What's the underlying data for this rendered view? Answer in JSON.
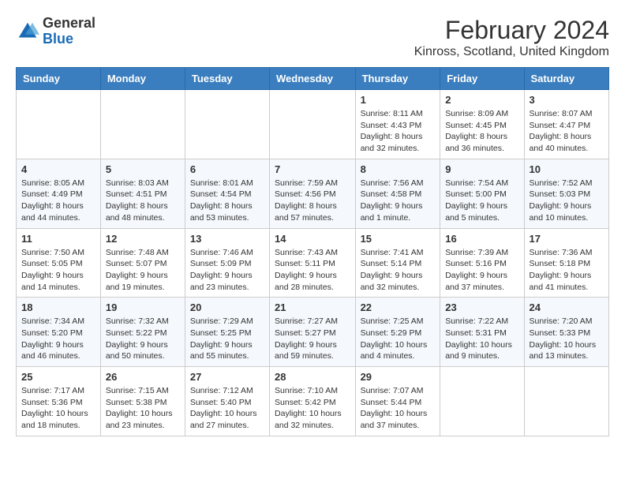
{
  "logo": {
    "general": "General",
    "blue": "Blue"
  },
  "title": "February 2024",
  "subtitle": "Kinross, Scotland, United Kingdom",
  "headers": [
    "Sunday",
    "Monday",
    "Tuesday",
    "Wednesday",
    "Thursday",
    "Friday",
    "Saturday"
  ],
  "weeks": [
    [
      {
        "day": "",
        "info": ""
      },
      {
        "day": "",
        "info": ""
      },
      {
        "day": "",
        "info": ""
      },
      {
        "day": "",
        "info": ""
      },
      {
        "day": "1",
        "info": "Sunrise: 8:11 AM\nSunset: 4:43 PM\nDaylight: 8 hours\nand 32 minutes."
      },
      {
        "day": "2",
        "info": "Sunrise: 8:09 AM\nSunset: 4:45 PM\nDaylight: 8 hours\nand 36 minutes."
      },
      {
        "day": "3",
        "info": "Sunrise: 8:07 AM\nSunset: 4:47 PM\nDaylight: 8 hours\nand 40 minutes."
      }
    ],
    [
      {
        "day": "4",
        "info": "Sunrise: 8:05 AM\nSunset: 4:49 PM\nDaylight: 8 hours\nand 44 minutes."
      },
      {
        "day": "5",
        "info": "Sunrise: 8:03 AM\nSunset: 4:51 PM\nDaylight: 8 hours\nand 48 minutes."
      },
      {
        "day": "6",
        "info": "Sunrise: 8:01 AM\nSunset: 4:54 PM\nDaylight: 8 hours\nand 53 minutes."
      },
      {
        "day": "7",
        "info": "Sunrise: 7:59 AM\nSunset: 4:56 PM\nDaylight: 8 hours\nand 57 minutes."
      },
      {
        "day": "8",
        "info": "Sunrise: 7:56 AM\nSunset: 4:58 PM\nDaylight: 9 hours\nand 1 minute."
      },
      {
        "day": "9",
        "info": "Sunrise: 7:54 AM\nSunset: 5:00 PM\nDaylight: 9 hours\nand 5 minutes."
      },
      {
        "day": "10",
        "info": "Sunrise: 7:52 AM\nSunset: 5:03 PM\nDaylight: 9 hours\nand 10 minutes."
      }
    ],
    [
      {
        "day": "11",
        "info": "Sunrise: 7:50 AM\nSunset: 5:05 PM\nDaylight: 9 hours\nand 14 minutes."
      },
      {
        "day": "12",
        "info": "Sunrise: 7:48 AM\nSunset: 5:07 PM\nDaylight: 9 hours\nand 19 minutes."
      },
      {
        "day": "13",
        "info": "Sunrise: 7:46 AM\nSunset: 5:09 PM\nDaylight: 9 hours\nand 23 minutes."
      },
      {
        "day": "14",
        "info": "Sunrise: 7:43 AM\nSunset: 5:11 PM\nDaylight: 9 hours\nand 28 minutes."
      },
      {
        "day": "15",
        "info": "Sunrise: 7:41 AM\nSunset: 5:14 PM\nDaylight: 9 hours\nand 32 minutes."
      },
      {
        "day": "16",
        "info": "Sunrise: 7:39 AM\nSunset: 5:16 PM\nDaylight: 9 hours\nand 37 minutes."
      },
      {
        "day": "17",
        "info": "Sunrise: 7:36 AM\nSunset: 5:18 PM\nDaylight: 9 hours\nand 41 minutes."
      }
    ],
    [
      {
        "day": "18",
        "info": "Sunrise: 7:34 AM\nSunset: 5:20 PM\nDaylight: 9 hours\nand 46 minutes."
      },
      {
        "day": "19",
        "info": "Sunrise: 7:32 AM\nSunset: 5:22 PM\nDaylight: 9 hours\nand 50 minutes."
      },
      {
        "day": "20",
        "info": "Sunrise: 7:29 AM\nSunset: 5:25 PM\nDaylight: 9 hours\nand 55 minutes."
      },
      {
        "day": "21",
        "info": "Sunrise: 7:27 AM\nSunset: 5:27 PM\nDaylight: 9 hours\nand 59 minutes."
      },
      {
        "day": "22",
        "info": "Sunrise: 7:25 AM\nSunset: 5:29 PM\nDaylight: 10 hours\nand 4 minutes."
      },
      {
        "day": "23",
        "info": "Sunrise: 7:22 AM\nSunset: 5:31 PM\nDaylight: 10 hours\nand 9 minutes."
      },
      {
        "day": "24",
        "info": "Sunrise: 7:20 AM\nSunset: 5:33 PM\nDaylight: 10 hours\nand 13 minutes."
      }
    ],
    [
      {
        "day": "25",
        "info": "Sunrise: 7:17 AM\nSunset: 5:36 PM\nDaylight: 10 hours\nand 18 minutes."
      },
      {
        "day": "26",
        "info": "Sunrise: 7:15 AM\nSunset: 5:38 PM\nDaylight: 10 hours\nand 23 minutes."
      },
      {
        "day": "27",
        "info": "Sunrise: 7:12 AM\nSunset: 5:40 PM\nDaylight: 10 hours\nand 27 minutes."
      },
      {
        "day": "28",
        "info": "Sunrise: 7:10 AM\nSunset: 5:42 PM\nDaylight: 10 hours\nand 32 minutes."
      },
      {
        "day": "29",
        "info": "Sunrise: 7:07 AM\nSunset: 5:44 PM\nDaylight: 10 hours\nand 37 minutes."
      },
      {
        "day": "",
        "info": ""
      },
      {
        "day": "",
        "info": ""
      }
    ]
  ]
}
